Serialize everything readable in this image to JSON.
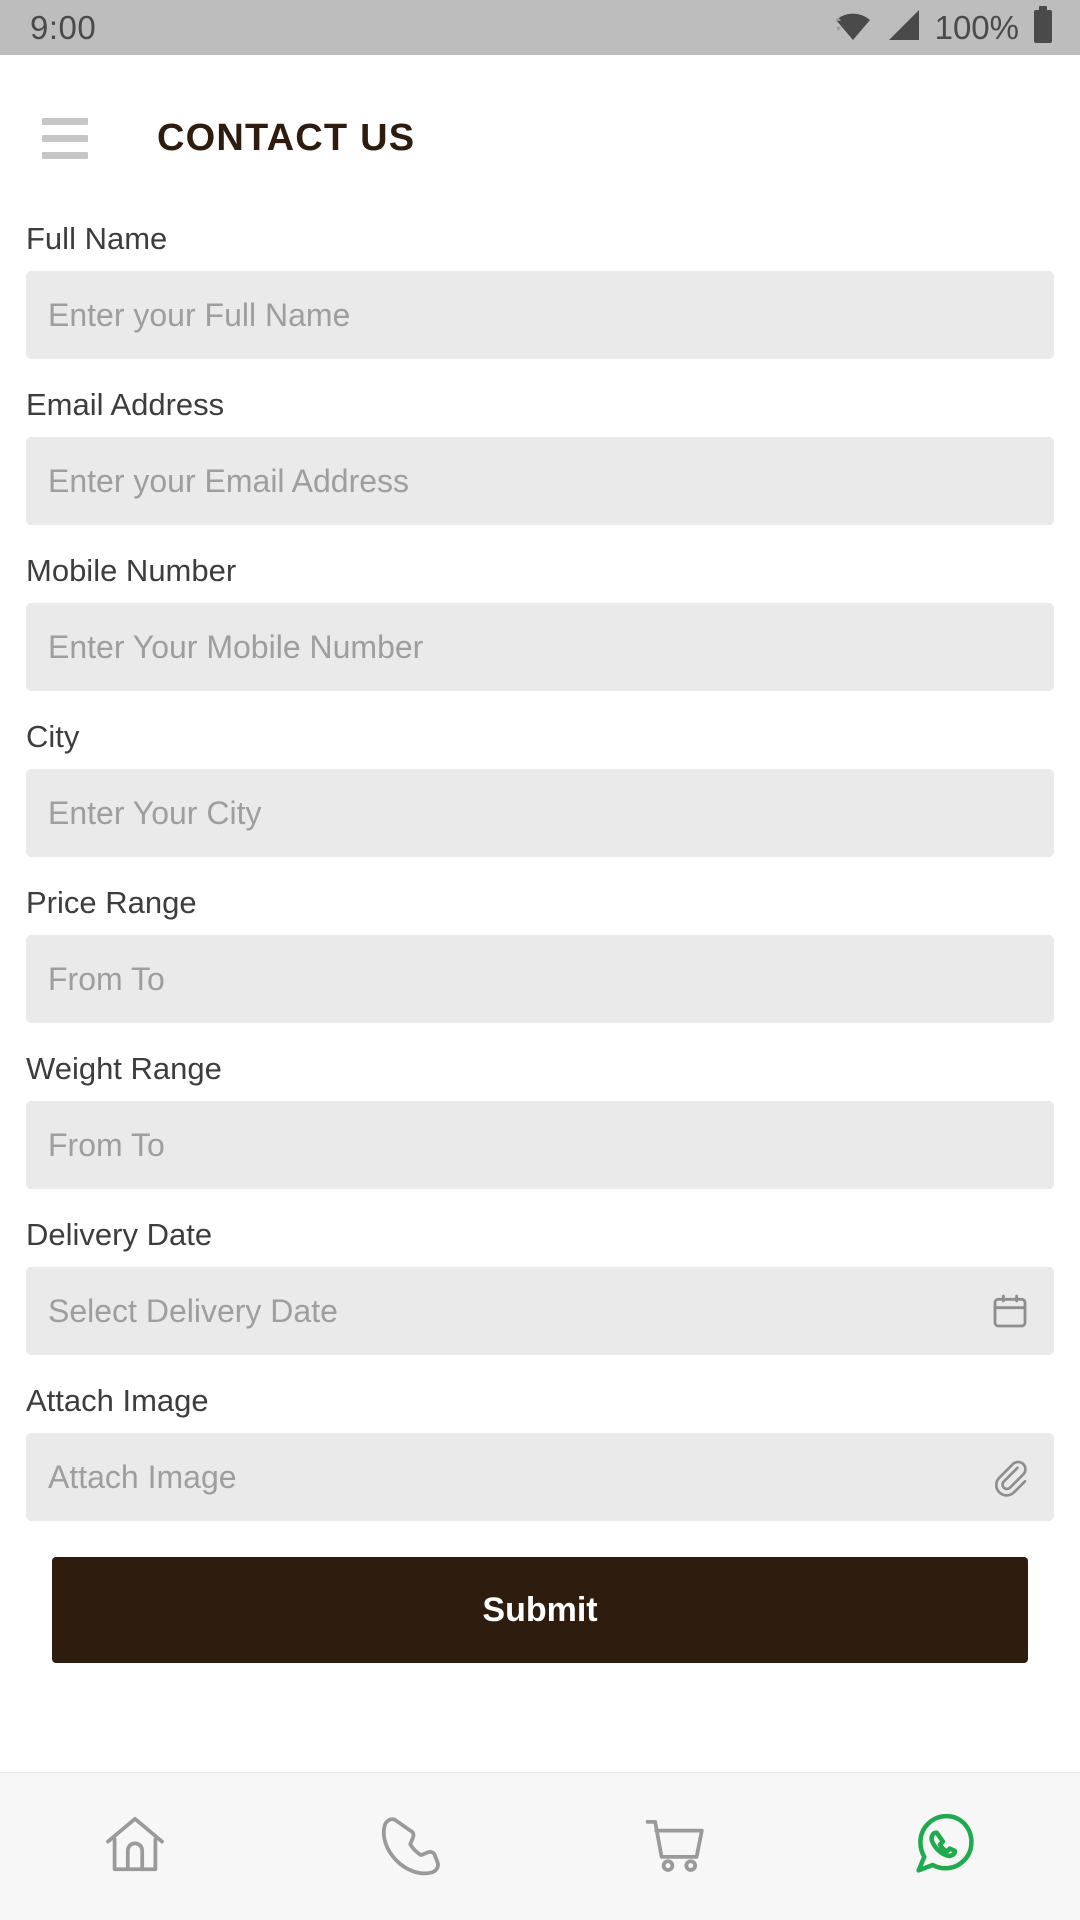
{
  "status_bar": {
    "time": "9:00",
    "battery_percent": "100%",
    "icons": [
      "wifi-icon",
      "signal-icon",
      "battery-icon"
    ]
  },
  "header": {
    "menu_icon": "hamburger-menu-icon",
    "title": "CONTACT US"
  },
  "colors": {
    "status_bar_bg": "#bdbdbd",
    "title": "#2e1c0f",
    "input_bg": "#eaeaea",
    "placeholder": "#9e9e9e",
    "submit_bg": "#2e1c0f",
    "whatsapp_green": "#1faa4e",
    "nav_icon": "#9a9a9a"
  },
  "form": {
    "fields": [
      {
        "label": "Full Name",
        "placeholder": "Enter your Full Name",
        "value": "",
        "icon": null
      },
      {
        "label": "Email Address",
        "placeholder": "Enter your Email Address",
        "value": "",
        "icon": null
      },
      {
        "label": "Mobile Number",
        "placeholder": "Enter Your Mobile Number",
        "value": "",
        "icon": null
      },
      {
        "label": "City",
        "placeholder": "Enter Your City",
        "value": "",
        "icon": null
      },
      {
        "label": "Price Range",
        "placeholder": "From To",
        "value": "",
        "icon": null
      },
      {
        "label": "Weight Range",
        "placeholder": "From To",
        "value": "",
        "icon": null
      },
      {
        "label": "Delivery Date",
        "placeholder": "Select Delivery Date",
        "value": "",
        "icon": "calendar-icon"
      },
      {
        "label": "Attach Image",
        "placeholder": "Attach Image",
        "value": "",
        "icon": "paperclip-icon"
      }
    ],
    "submit_label": "Submit"
  },
  "bottom_nav": {
    "items": [
      {
        "name": "home",
        "icon": "home-icon"
      },
      {
        "name": "call",
        "icon": "phone-icon"
      },
      {
        "name": "cart",
        "icon": "shopping-cart-icon"
      },
      {
        "name": "whatsapp",
        "icon": "whatsapp-icon"
      }
    ]
  }
}
